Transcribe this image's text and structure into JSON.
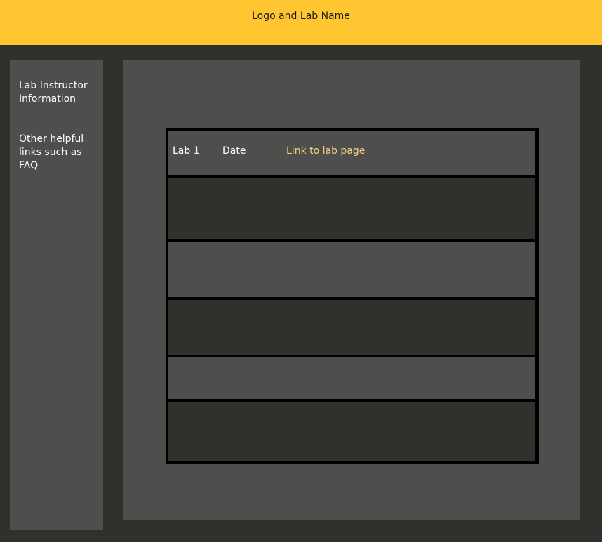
{
  "header": {
    "title": "Logo and Lab Name",
    "background_color": "#ffc632"
  },
  "sidebar": {
    "instructor_info": "Lab Instructor Information",
    "helpful_links": "Other helpful links such as FAQ"
  },
  "lab_table": {
    "rows": [
      {
        "lab": "Lab 1",
        "date": "Date",
        "link": "Link to lab page",
        "shade": "light"
      },
      {
        "lab": "",
        "date": "",
        "link": "",
        "shade": "dark"
      },
      {
        "lab": "",
        "date": "",
        "link": "",
        "shade": "light"
      },
      {
        "lab": "",
        "date": "",
        "link": "",
        "shade": "dark"
      },
      {
        "lab": "",
        "date": "",
        "link": "",
        "shade": "light"
      },
      {
        "lab": "",
        "date": "",
        "link": "",
        "shade": "dark"
      }
    ],
    "link_color": "#f2cf84"
  },
  "colors": {
    "page_background": "#32302c",
    "panel_background": "#4e4e4c",
    "row_dark": "#32302c",
    "row_light": "#4e4e4c",
    "table_border": "#000000"
  }
}
